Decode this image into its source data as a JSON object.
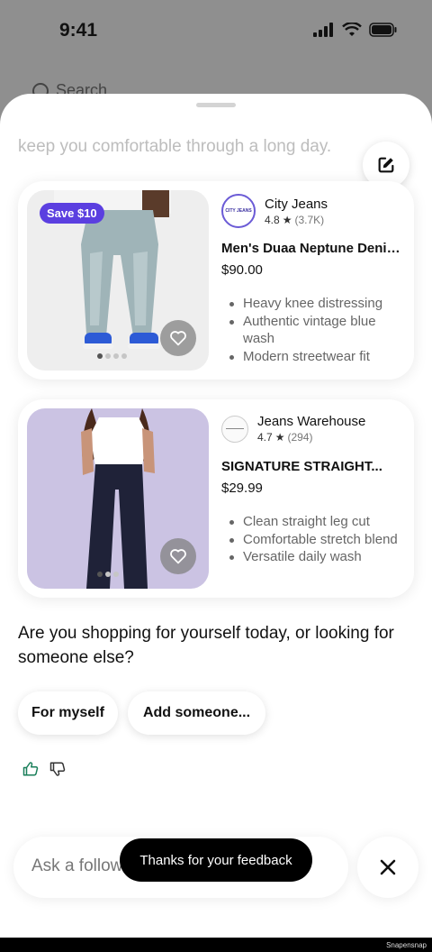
{
  "status_bar": {
    "time": "9:41"
  },
  "background": {
    "search_placeholder": "Search"
  },
  "chat": {
    "previous_text": "keep you comfortable through a long day.",
    "question": "Are you shopping for yourself today, or looking for someone else?",
    "chips": [
      "For myself",
      "Add someone..."
    ]
  },
  "products": [
    {
      "badge": "Save $10",
      "logo_text": "CITY JEANS",
      "brand": "City Jeans",
      "rating": "4.8",
      "review_count": "(3.7K)",
      "title": "Men's Duaa Neptune Denim...",
      "price": "$90.00",
      "features": [
        "Heavy knee distressing",
        "Authentic vintage blue wash",
        "Modern streetwear fit"
      ]
    },
    {
      "brand": "Jeans Warehouse",
      "rating": "4.7",
      "review_count": "(294)",
      "title": "SIGNATURE STRAIGHT...",
      "price": "$29.99",
      "features": [
        "Clean straight leg cut",
        "Comfortable stretch blend",
        "Versatile daily wash"
      ]
    }
  ],
  "composer": {
    "placeholder": "Ask a follow"
  },
  "toast": "Thanks for your feedback",
  "watermark": "Snapensnap",
  "colors": {
    "badge": "#5b3fe0",
    "thumb_up": "#1a7f5a",
    "card2_bg": "#cbc3e3"
  },
  "icons": [
    "signal-icon",
    "wifi-icon",
    "battery-icon",
    "search-icon",
    "edit-icon",
    "star-icon",
    "heart-icon",
    "thumbs-up-icon",
    "thumbs-down-icon",
    "close-icon"
  ]
}
